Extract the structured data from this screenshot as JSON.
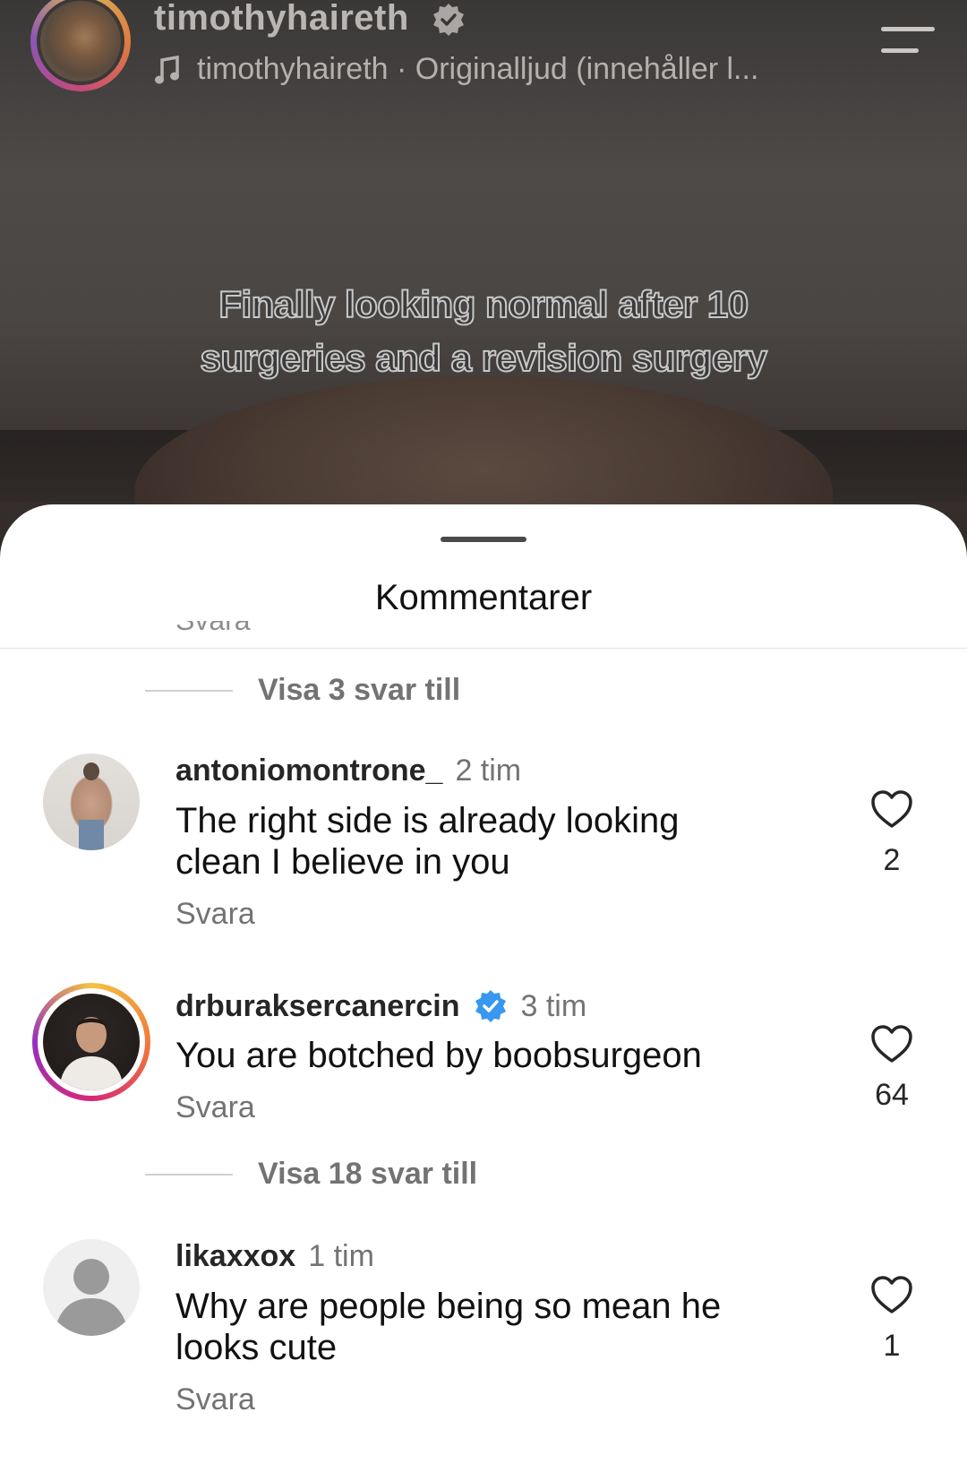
{
  "header": {
    "username": "timothyhaireth",
    "audio": "timothyhaireth · Originalljud (innehåller l...",
    "caption_line1": "Finally looking normal after 10",
    "caption_line2": "surgeries and a revision surgery"
  },
  "sheet": {
    "title": "Kommentarer",
    "cut_reply_label": "Svara",
    "show_more_1": "Visa 3 svar till",
    "show_more_2": "Visa 18 svar till"
  },
  "comments": [
    {
      "username": "antoniomontrone_",
      "time": "2 tim",
      "text_line1": "The right side is already looking",
      "text_line2": "clean I believe in you",
      "reply": "Svara",
      "likes": "2"
    },
    {
      "username": "drburaksercanercin",
      "time": "3 tim",
      "text_line1": "You are botched by boobsurgeon",
      "reply": "Svara",
      "likes": "64",
      "verified": true
    },
    {
      "username": "likaxxox",
      "time": "1 tim",
      "text_line1": "Why are people being so mean he",
      "text_line2": "looks cute",
      "reply": "Svara",
      "likes": "1"
    }
  ],
  "colors": {
    "verified_blue": "#3897f0",
    "muted_text": "#737373",
    "story_ring": [
      "#d6b25c",
      "#e07c3e",
      "#c64a7a",
      "#8a55b6"
    ]
  },
  "icons": [
    "verified-badge-icon",
    "music-note-icon",
    "menu-icon",
    "heart-icon",
    "default-avatar-icon"
  ]
}
